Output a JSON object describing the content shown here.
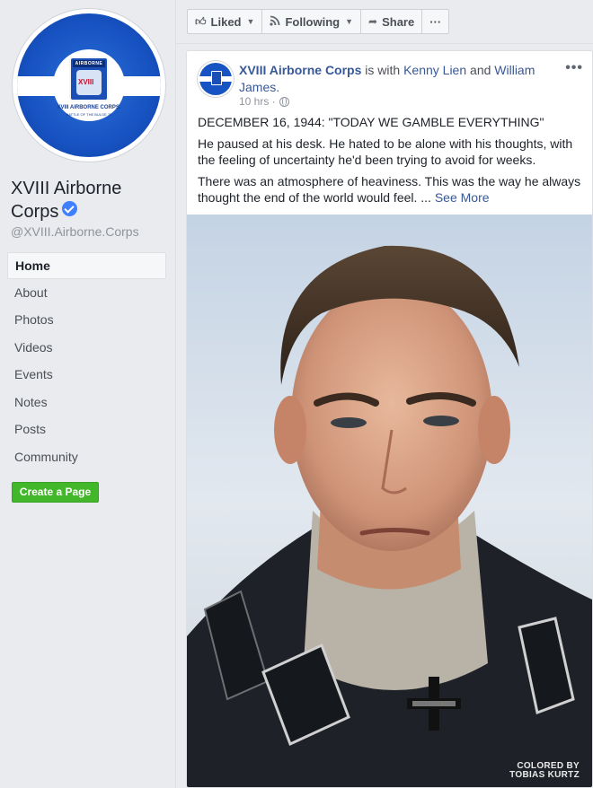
{
  "page": {
    "name_line1": "XVIII Airborne",
    "name_line2": "Corps",
    "handle": "@XVIII.Airborne.Corps",
    "logo_text_top": "AIRBORNE",
    "logo_caption": "XVIII AIRBORNE CORPS.",
    "logo_caption2": "BATTLE OF THE BULGE 75"
  },
  "nav": {
    "items": [
      {
        "label": "Home"
      },
      {
        "label": "About"
      },
      {
        "label": "Photos"
      },
      {
        "label": "Videos"
      },
      {
        "label": "Events"
      },
      {
        "label": "Notes"
      },
      {
        "label": "Posts"
      },
      {
        "label": "Community"
      }
    ],
    "create_page": "Create a Page"
  },
  "actions": {
    "liked": "Liked",
    "following": "Following",
    "share": "Share",
    "more": "···"
  },
  "post": {
    "author": "XVIII Airborne Corps",
    "is_with": "is with",
    "tag1": "Kenny Lien",
    "and": "and",
    "tag2": "William James.",
    "time": "10 hrs ·",
    "menu": "•••",
    "headline": "DECEMBER 16, 1944: \"TODAY WE GAMBLE EVERYTHING\"",
    "para1": "He paused at his desk. He hated to be alone with his thoughts, with the feeling of uncertainty he'd been trying to avoid for weeks.",
    "para2": "There was an atmosphere of heaviness. This was the way he always thought the end of the world would feel. ...",
    "see_more": "See More",
    "photo_credit_1": "COLORED BY",
    "photo_credit_2": "TOBIAS KURTZ"
  },
  "colors": {
    "link": "#385898",
    "create_button": "#42b72a",
    "verified": "#4080ff",
    "logo_blue": "#1753c2"
  }
}
